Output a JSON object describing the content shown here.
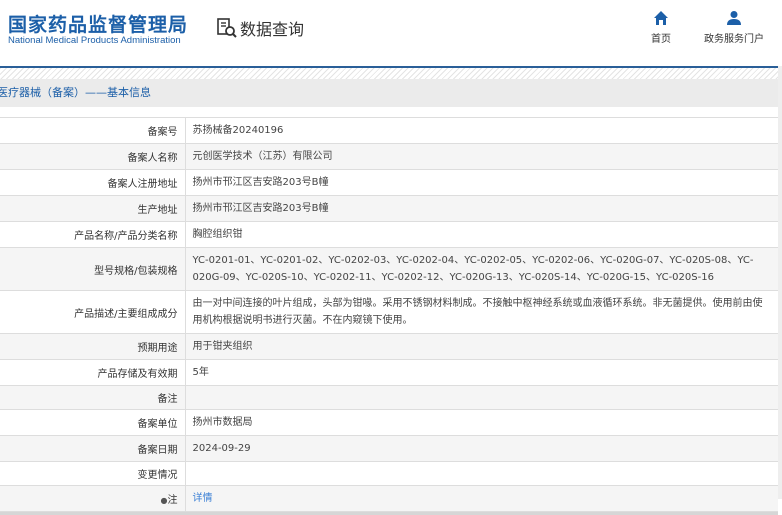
{
  "header": {
    "logo_cn": "国家药品监督管理局",
    "logo_en": "National Medical Products Administration",
    "query_label": "数据查询",
    "nav": [
      {
        "label": "首页",
        "icon": "home-icon"
      },
      {
        "label": "政务服务门户",
        "icon": "user-icon"
      }
    ]
  },
  "breadcrumb": "医疗器械（备案）——基本信息",
  "rows": [
    {
      "label": "备案号",
      "value": "苏扬械备20240196"
    },
    {
      "label": "备案人名称",
      "value": "元创医学技术（江苏）有限公司"
    },
    {
      "label": "备案人注册地址",
      "value": "扬州市邗江区吉安路203号B幢"
    },
    {
      "label": "生产地址",
      "value": "扬州市邗江区吉安路203号B幢"
    },
    {
      "label": "产品名称/产品分类名称",
      "value": "胸腔组织钳"
    },
    {
      "label": "型号规格/包装规格",
      "value": "YC-0201-01、YC-0201-02、YC-0202-03、YC-0202-04、YC-0202-05、YC-0202-06、YC-020G-07、YC-020S-08、YC-020G-09、YC-020S-10、YC-0202-11、YC-0202-12、YC-020G-13、YC-020S-14、YC-020G-15、YC-020S-16"
    },
    {
      "label": "产品描述/主要组成成分",
      "value": "由一对中间连接的叶片组成，头部为钳喙。采用不锈钢材料制成。不接触中枢神经系统或血液循环系统。非无菌提供。使用前由使用机构根据说明书进行灭菌。不在内窥镜下使用。"
    },
    {
      "label": "预期用途",
      "value": "用于钳夹组织"
    },
    {
      "label": "产品存储及有效期",
      "value": "5年"
    },
    {
      "label": "备注",
      "value": ""
    },
    {
      "label": "备案单位",
      "value": "扬州市数据局"
    },
    {
      "label": "备案日期",
      "value": "2024-09-29"
    },
    {
      "label": "变更情况",
      "value": ""
    },
    {
      "label": "注",
      "value": "详情"
    }
  ]
}
